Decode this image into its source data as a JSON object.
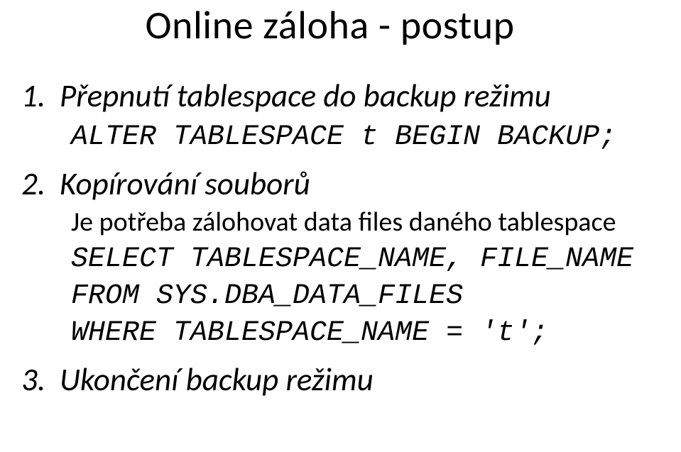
{
  "title": "Online záloha - postup",
  "items": [
    {
      "number": "1.",
      "heading": "Přepnutí tablespace do backup režimu",
      "code": "ALTER TABLESPACE t BEGIN BACKUP;"
    },
    {
      "number": "2.",
      "heading": "Kopírování souborů",
      "subtext": "Je potřeba zálohovat data files daného tablespace",
      "code": "SELECT TABLESPACE_NAME, FILE_NAME\nFROM SYS.DBA_DATA_FILES\nWHERE TABLESPACE_NAME = 't';"
    },
    {
      "number": "3.",
      "heading": "Ukončení backup režimu"
    }
  ]
}
